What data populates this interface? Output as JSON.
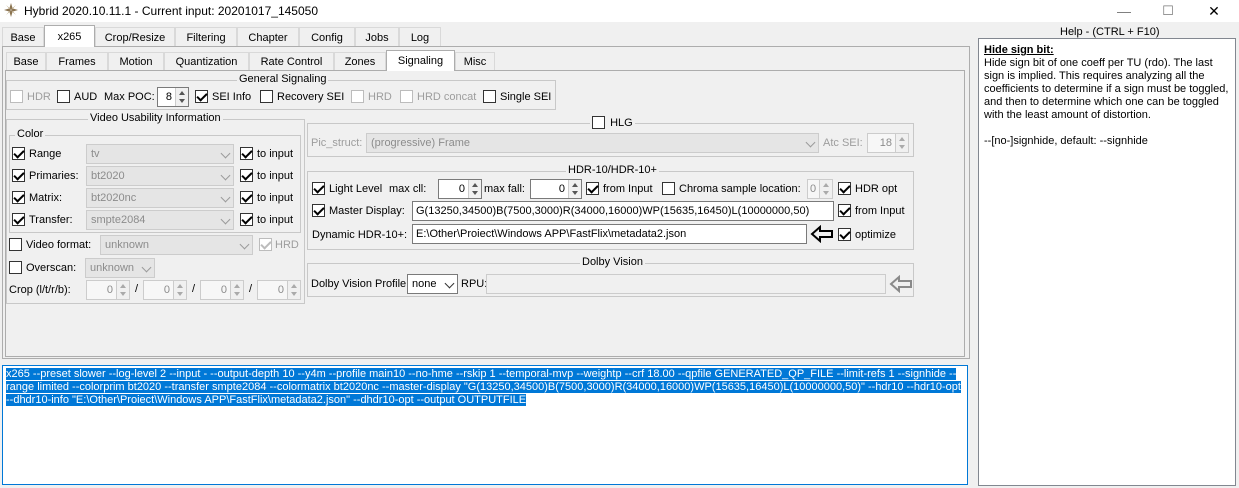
{
  "window": {
    "title": "Hybrid 2020.10.11.1 - Current input: 20201017_145050",
    "minimize": "—",
    "maximize": "☐",
    "close": "✕"
  },
  "main_tabs": [
    "Base",
    "x265",
    "Crop/Resize",
    "Filtering",
    "Chapter",
    "Config",
    "Jobs",
    "Log"
  ],
  "sub_tabs": [
    "Base",
    "Frames",
    "Motion",
    "Quantization",
    "Rate Control",
    "Zones",
    "Signaling",
    "Misc"
  ],
  "general_signaling": {
    "title": "General Signaling",
    "hdr": "HDR",
    "aud": "AUD",
    "max_poc_label": "Max POC:",
    "max_poc_value": "8",
    "sei_info": "SEI Info",
    "recovery_sei": "Recovery SEI",
    "hrd": "HRD",
    "hrd_concat": "HRD concat",
    "single_sei": "Single SEI"
  },
  "vui": {
    "title": "Video Usability Information",
    "color_title": "Color",
    "rows": [
      {
        "label": "Range",
        "value": "tv",
        "to_input": "to input"
      },
      {
        "label": "Primaries:",
        "value": "bt2020",
        "to_input": "to input"
      },
      {
        "label": "Matrix:",
        "value": "bt2020nc",
        "to_input": "to input"
      },
      {
        "label": "Transfer:",
        "value": "smpte2084",
        "to_input": "to input"
      }
    ],
    "video_format_label": "Video format:",
    "video_format_value": "unknown",
    "hrd": "HRD",
    "overscan_label": "Overscan:",
    "overscan_value": "unknown",
    "crop_label": "Crop (l/t/r/b):",
    "crop_values": [
      "0",
      "0",
      "0",
      "0"
    ],
    "slash": "/"
  },
  "hlg": {
    "label": "HLG",
    "pic_struct_label": "Pic_struct:",
    "pic_struct_value": "(progressive) Frame",
    "atc_sei_label": "Atc SEI:",
    "atc_sei_value": "18"
  },
  "hdr10": {
    "title": "HDR-10/HDR-10+",
    "light_level": "Light Level",
    "max_cll_label": "max cll:",
    "max_cll_value": "0",
    "max_fall_label": "max fall:",
    "max_fall_value": "0",
    "from_input": "from Input",
    "chroma_label": "Chroma sample location:",
    "chroma_value": "0",
    "hdr_opt": "HDR opt",
    "master_display_label": "Master Display:",
    "master_display_value": "G(13250,34500)B(7500,3000)R(34000,16000)WP(15635,16450)L(10000000,50)",
    "master_from_input": "from Input",
    "dynamic_label": "Dynamic HDR-10+:",
    "dynamic_value": "E:\\Other\\Proiect\\Windows APP\\FastFlix\\metadata2.json",
    "optimize": "optimize"
  },
  "dolby": {
    "title": "Dolby Vision",
    "profile_label": "Dolby Vision Profile:",
    "profile_value": "none",
    "rpu_label": "RPU:",
    "rpu_value": ""
  },
  "command_line": "x265 --preset slower --log-level 2 --input - --output-depth 10 --y4m --profile main10   --no-hme --rskip 1 --temporal-mvp --weightp --crf 18.00 --qpfile GENERATED_QP_FILE --limit-refs 1 --signhide --range limited --colorprim bt2020 --transfer smpte2084 --colormatrix bt2020nc --master-display \"G(13250,34500)B(7500,3000)R(34000,16000)WP(15635,16450)L(10000000,50)\" --hdr10 --hdr10-opt --dhdr10-info \"E:\\Other\\Proiect\\Windows APP\\FastFlix\\metadata2.json\" --dhdr10-opt --output OUTPUTFILE",
  "help": {
    "header": "Help - (CTRL + F10)",
    "title": "Hide sign bit:",
    "body": "Hide sign bit of one coeff per TU (rdo). The last sign is implied. This requires analyzing all the coefficients to determine if a sign must be toggled, and then to determine which one can be toggled with the least amount of distortion.",
    "default": "--[no-]signhide, default: --signhide"
  },
  "colors": {
    "accent": "#0078d7",
    "background": "#f0f0f0"
  },
  "icons": {
    "app": "hybrid-logo-icon",
    "arrow_dynamic": "left-arrow-icon",
    "arrow_rpu": "left-arrow-icon"
  }
}
